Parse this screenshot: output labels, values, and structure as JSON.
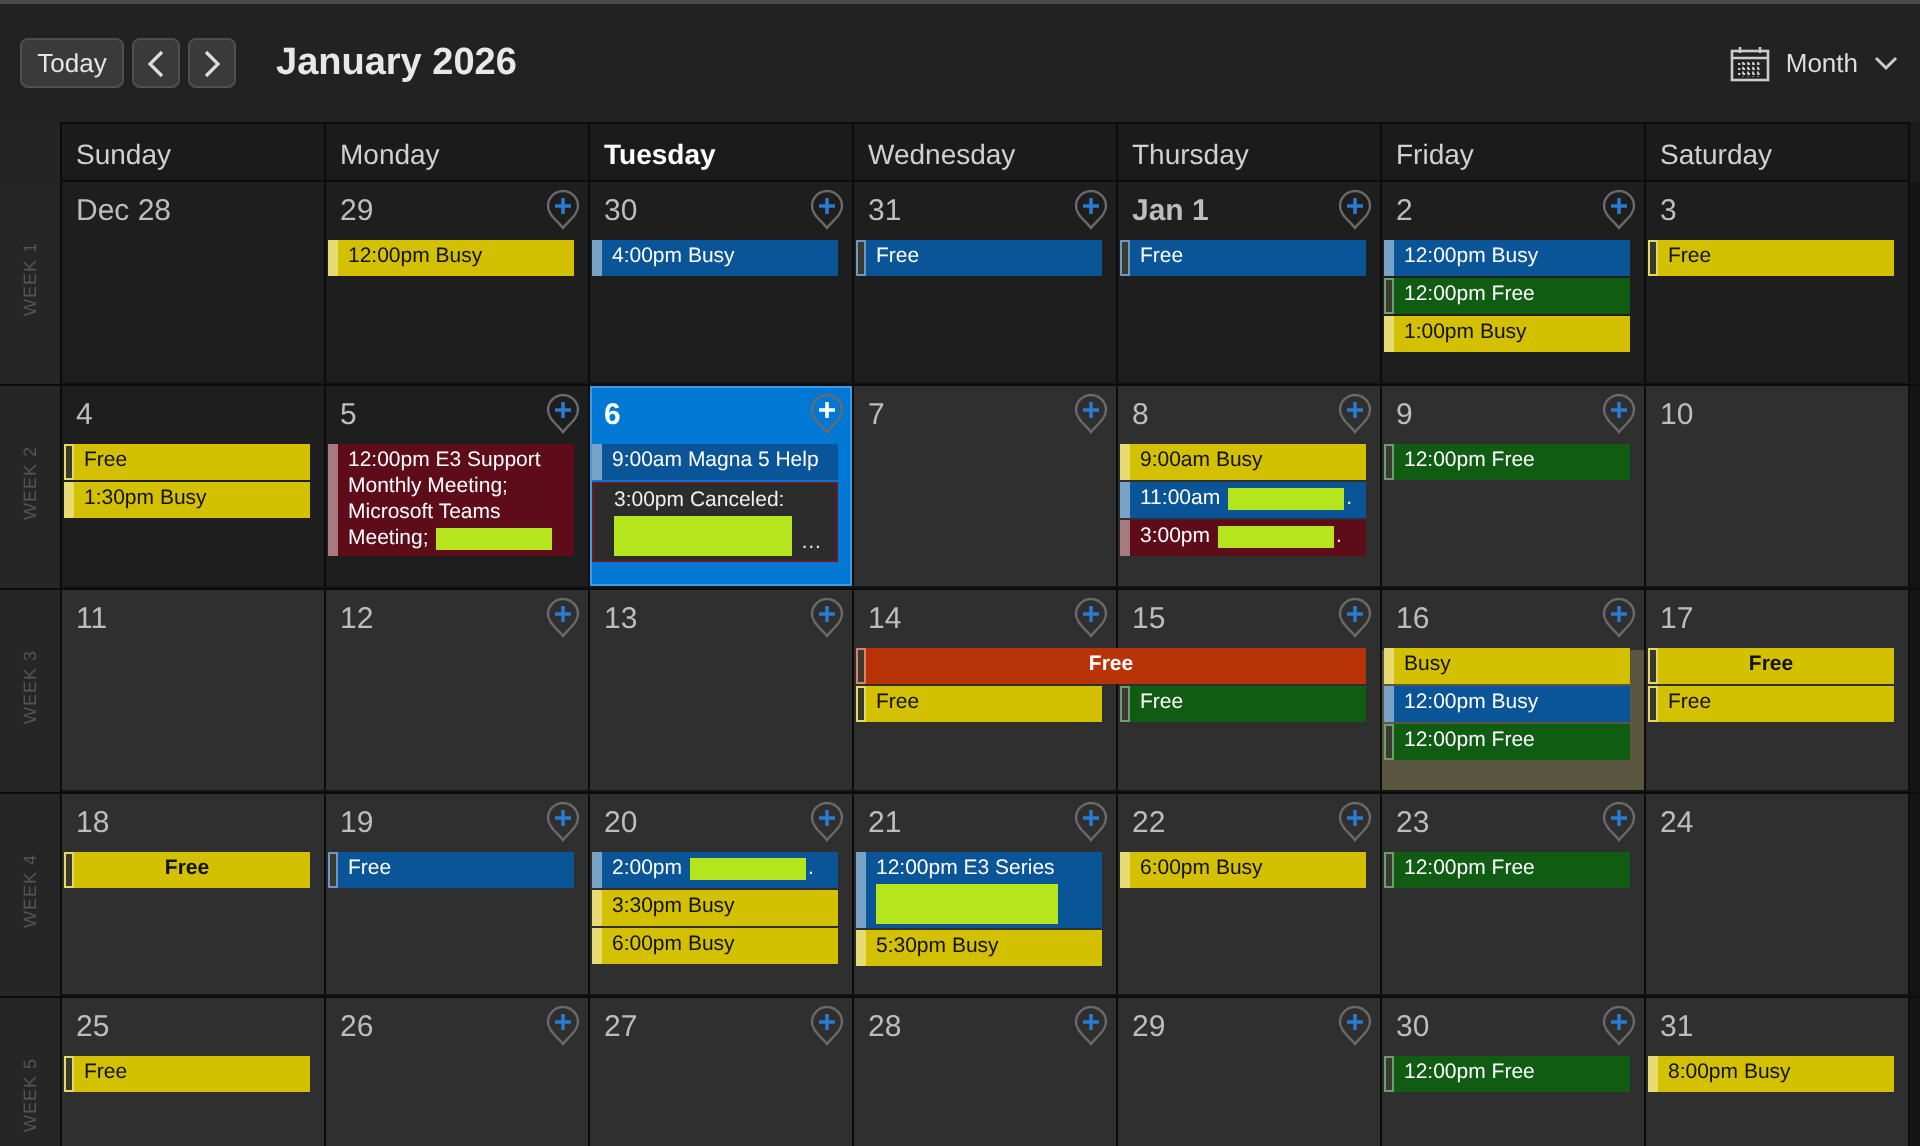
{
  "toolbar": {
    "today_button": "Today",
    "title": "January 2026",
    "view_switch": "Month"
  },
  "day_headers": [
    {
      "label": "Sunday",
      "today": false
    },
    {
      "label": "Monday",
      "today": false
    },
    {
      "label": "Tuesday",
      "today": true
    },
    {
      "label": "Wednesday",
      "today": false
    },
    {
      "label": "Thursday",
      "today": false
    },
    {
      "label": "Friday",
      "today": false
    },
    {
      "label": "Saturday",
      "today": false
    }
  ],
  "weeks": [
    {
      "label": "WEEK 1",
      "days": [
        {
          "number": "Dec 28",
          "past": true,
          "today": false,
          "month_start": false,
          "highlighted": false,
          "add_button": false
        },
        {
          "number": "29",
          "past": true,
          "today": false,
          "month_start": false,
          "highlighted": false,
          "add_button": true,
          "events": [
            {
              "text": "12:00pm Busy",
              "color": "#d3c000",
              "kind": "busy"
            }
          ]
        },
        {
          "number": "30",
          "past": true,
          "today": false,
          "month_start": false,
          "highlighted": false,
          "add_button": true,
          "events": [
            {
              "text": "4:00pm Busy",
              "color": "#0a5597",
              "kind": "busy"
            }
          ]
        },
        {
          "number": "31",
          "past": true,
          "today": false,
          "month_start": false,
          "highlighted": false,
          "add_button": true,
          "events": [
            {
              "text": "Free",
              "color": "#0a5597",
              "kind": "free"
            }
          ]
        },
        {
          "number": "Jan 1",
          "past": true,
          "today": false,
          "month_start": true,
          "highlighted": false,
          "add_button": true,
          "events": [
            {
              "text": "Free",
              "color": "#0a5597",
              "kind": "free"
            }
          ]
        },
        {
          "number": "2",
          "past": true,
          "today": false,
          "month_start": false,
          "highlighted": false,
          "add_button": true,
          "events": [
            {
              "text": "12:00pm Busy",
              "color": "#0a5597",
              "kind": "busy"
            },
            {
              "text": "12:00pm Free",
              "color": "#0f5c12",
              "kind": "free"
            },
            {
              "text": "1:00pm Busy",
              "color": "#d3c000",
              "kind": "busy"
            }
          ]
        },
        {
          "number": "3",
          "past": true,
          "today": false,
          "month_start": false,
          "highlighted": false,
          "add_button": false,
          "events": [
            {
              "text": "Free",
              "color": "#d3c000",
              "kind": "free"
            }
          ]
        }
      ]
    },
    {
      "label": "WEEK 2",
      "days": [
        {
          "number": "4",
          "past": true,
          "today": false,
          "month_start": false,
          "highlighted": false,
          "add_button": false,
          "events": [
            {
              "text": "Free",
              "color": "#d3c000",
              "kind": "free"
            },
            {
              "text": "1:30pm Busy",
              "color": "#d3c000",
              "kind": "busy"
            }
          ]
        },
        {
          "number": "5",
          "past": true,
          "today": false,
          "month_start": false,
          "highlighted": false,
          "add_button": true,
          "events": [
            {
              "text": "12:00pm E3 Support Monthly Meeting; Microsoft Teams Meeting;",
              "color": "#5f0c1a",
              "kind": "busy",
              "redaction": {
                "kind": "inline"
              }
            }
          ]
        },
        {
          "number": "6",
          "past": false,
          "today": true,
          "month_start": false,
          "highlighted": false,
          "add_button": true,
          "events": [
            {
              "text": "9:00am Magna 5 Help",
              "color": "#0a5597",
              "kind": "busy"
            },
            {
              "text": "3:00pm Canceled:",
              "color": "#6b1a24",
              "kind": "canceled",
              "redaction": {
                "kind": "block"
              },
              "tail": "…"
            }
          ]
        },
        {
          "number": "7",
          "past": false,
          "today": false,
          "month_start": false,
          "highlighted": false,
          "add_button": true
        },
        {
          "number": "8",
          "past": false,
          "today": false,
          "month_start": false,
          "highlighted": false,
          "add_button": true,
          "events": [
            {
              "text": "9:00am Busy",
              "color": "#d3c000",
              "kind": "busy"
            },
            {
              "text": "11:00am",
              "color": "#0a5597",
              "kind": "busy",
              "redaction": {
                "kind": "inline"
              },
              "tail": "."
            },
            {
              "text": "3:00pm",
              "color": "#5f0c1a",
              "kind": "busy",
              "redaction": {
                "kind": "inline"
              },
              "tail": "."
            }
          ]
        },
        {
          "number": "9",
          "past": false,
          "today": false,
          "month_start": false,
          "highlighted": false,
          "add_button": true,
          "events": [
            {
              "text": "12:00pm Free",
              "color": "#0f5c12",
              "kind": "free"
            }
          ]
        },
        {
          "number": "10",
          "past": false,
          "today": false,
          "month_start": false,
          "highlighted": false,
          "add_button": false
        }
      ]
    },
    {
      "label": "WEEK 3",
      "days": [
        {
          "number": "11",
          "past": false,
          "today": false,
          "month_start": false,
          "highlighted": false,
          "add_button": false
        },
        {
          "number": "12",
          "past": false,
          "today": false,
          "month_start": false,
          "highlighted": false,
          "add_button": true
        },
        {
          "number": "13",
          "past": false,
          "today": false,
          "month_start": false,
          "highlighted": false,
          "add_button": true
        },
        {
          "number": "14",
          "past": false,
          "today": false,
          "month_start": false,
          "highlighted": false,
          "add_button": true,
          "events": [
            {
              "text": "Free",
              "color": "#b83308",
              "kind": "free",
              "all_day": true,
              "multi_day": true
            },
            {
              "text": "Free",
              "color": "#d3c000",
              "kind": "free"
            }
          ]
        },
        {
          "number": "15",
          "past": false,
          "today": false,
          "month_start": false,
          "highlighted": false,
          "add_button": true,
          "events": [
            {
              "text": "Free",
              "color": "#0f5c12",
              "kind": "free"
            }
          ]
        },
        {
          "number": "16",
          "past": false,
          "today": false,
          "month_start": false,
          "highlighted": true,
          "add_button": true,
          "events": [
            {
              "text": "Busy",
              "color": "#d3c000",
              "kind": "busy"
            },
            {
              "text": "12:00pm Busy",
              "color": "#0a5597",
              "kind": "busy"
            },
            {
              "text": "12:00pm Free",
              "color": "#0f5c12",
              "kind": "free"
            }
          ]
        },
        {
          "number": "17",
          "past": false,
          "today": false,
          "month_start": false,
          "highlighted": false,
          "add_button": false,
          "events": [
            {
              "text": "Free",
              "color": "#d3c000",
              "kind": "free",
              "all_day": true
            },
            {
              "text": "Free",
              "color": "#d3c000",
              "kind": "free"
            }
          ]
        }
      ]
    },
    {
      "label": "WEEK 4",
      "days": [
        {
          "number": "18",
          "past": false,
          "today": false,
          "month_start": false,
          "highlighted": false,
          "add_button": false,
          "events": [
            {
              "text": "Free",
              "color": "#d3c000",
              "kind": "free",
              "all_day": true
            }
          ]
        },
        {
          "number": "19",
          "past": false,
          "today": false,
          "month_start": false,
          "highlighted": false,
          "add_button": true,
          "events": [
            {
              "text": "Free",
              "color": "#0a5597",
              "kind": "free"
            }
          ]
        },
        {
          "number": "20",
          "past": false,
          "today": false,
          "month_start": false,
          "highlighted": false,
          "add_button": true,
          "events": [
            {
              "text": "2:00pm",
              "color": "#0a5597",
              "kind": "busy",
              "redaction": {
                "kind": "inline"
              },
              "tail": "."
            },
            {
              "text": "3:30pm Busy",
              "color": "#d3c000",
              "kind": "busy"
            },
            {
              "text": "6:00pm Busy",
              "color": "#d3c000",
              "kind": "busy"
            }
          ]
        },
        {
          "number": "21",
          "past": false,
          "today": false,
          "month_start": false,
          "highlighted": false,
          "add_button": true,
          "events": [
            {
              "text": "12:00pm E3 Series",
              "color": "#0a5597",
              "kind": "busy",
              "redaction": {
                "kind": "block"
              }
            },
            {
              "text": "5:30pm Busy",
              "color": "#d3c000",
              "kind": "busy"
            }
          ]
        },
        {
          "number": "22",
          "past": false,
          "today": false,
          "month_start": false,
          "highlighted": false,
          "add_button": true,
          "events": [
            {
              "text": "6:00pm Busy",
              "color": "#d3c000",
              "kind": "busy"
            }
          ]
        },
        {
          "number": "23",
          "past": false,
          "today": false,
          "month_start": false,
          "highlighted": false,
          "add_button": true,
          "events": [
            {
              "text": "12:00pm Free",
              "color": "#0f5c12",
              "kind": "free"
            }
          ]
        },
        {
          "number": "24",
          "past": false,
          "today": false,
          "month_start": false,
          "highlighted": false,
          "add_button": false
        }
      ]
    },
    {
      "label": "WEEK 5",
      "days": [
        {
          "number": "25",
          "past": false,
          "today": false,
          "month_start": false,
          "highlighted": false,
          "add_button": false,
          "events": [
            {
              "text": "Free",
              "color": "#d3c000",
              "kind": "free"
            }
          ]
        },
        {
          "number": "26",
          "past": false,
          "today": false,
          "month_start": false,
          "highlighted": false,
          "add_button": true
        },
        {
          "number": "27",
          "past": false,
          "today": false,
          "month_start": false,
          "highlighted": false,
          "add_button": true
        },
        {
          "number": "28",
          "past": false,
          "today": false,
          "month_start": false,
          "highlighted": false,
          "add_button": true
        },
        {
          "number": "29",
          "past": false,
          "today": false,
          "month_start": false,
          "highlighted": false,
          "add_button": true
        },
        {
          "number": "30",
          "past": false,
          "today": false,
          "month_start": false,
          "highlighted": false,
          "add_button": true,
          "events": [
            {
              "text": "12:00pm Free",
              "color": "#0f5c12",
              "kind": "free"
            }
          ]
        },
        {
          "number": "31",
          "past": false,
          "today": false,
          "month_start": false,
          "highlighted": false,
          "add_button": false,
          "events": [
            {
              "text": "8:00pm Busy",
              "color": "#d3c000",
              "kind": "busy"
            }
          ]
        }
      ]
    }
  ]
}
